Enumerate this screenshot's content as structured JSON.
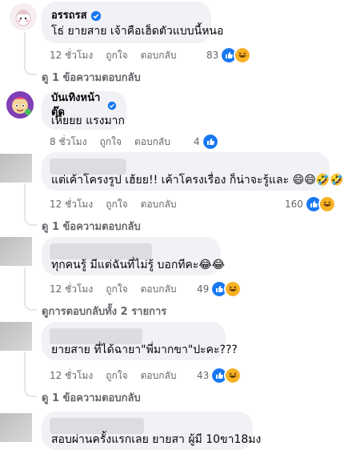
{
  "comments": [
    {
      "author": "อรรถรส",
      "verified": true,
      "text": "โธ่ ยายสาย เจ้าคือเฮ็ดตัวแบบนี้หนอ",
      "time": "12 ชั่วโมง",
      "like": "ถูกใจ",
      "reply": "ตอบกลับ",
      "reaction_count": "83",
      "replies": "ดู 1 ข้อความตอบกลับ"
    },
    {
      "author": "บันเทิงหน้าตุ๊ด",
      "verified": true,
      "text": "เหี้ยยย แรงมาก",
      "time": "8 ชั่วโมง",
      "like": "ถูกใจ",
      "reply": "ตอบกลับ",
      "reaction_count": "4",
      "replies": ""
    },
    {
      "author": "",
      "verified": false,
      "text": "แต่เค้าโครงรูป เฮ้ยย!! เค้าโครงเรื่อง ก็น่าจะรู้และ 😄😄🤣🤣",
      "time": "12 ชั่วโมง",
      "like": "ถูกใจ",
      "reply": "ตอบกลับ",
      "reaction_count": "160",
      "replies": "ดู 1 ข้อความตอบกลับ"
    },
    {
      "author": "",
      "verified": false,
      "text": "ทุกคนรู้ มีแต่ฉันที่ไม่รู้ บอกทีคะ😂😂",
      "time": "12 ชั่วโมง",
      "like": "ถูกใจ",
      "reply": "ตอบกลับ",
      "reaction_count": "49",
      "replies": "ดูการตอบกลับทั้ง 2 รายการ"
    },
    {
      "author": "",
      "verified": false,
      "text": "ยายสาย ที่ได้ฉายา\"พี่มากขา\"ปะคะ???",
      "time": "12 ชั่วโมง",
      "like": "ถูกใจ",
      "reply": "ตอบกลับ",
      "reaction_count": "43",
      "replies": "ดู 1 ข้อความตอบกลับ"
    },
    {
      "author": "",
      "verified": false,
      "text": "สอบผ่านครั้งแรกเลย ยายสา ผู้มี 10ขา18มง",
      "time": "",
      "like": "",
      "reply": "",
      "reaction_count": "",
      "replies": ""
    }
  ],
  "colors": {
    "like_blue": "#1877f2",
    "haha_yellow": "#f7b125",
    "bubble_bg": "#f0f2f5",
    "meta_gray": "#65676b"
  },
  "icons": [
    "verified-badge-icon",
    "like-reaction-icon",
    "haha-reaction-icon",
    "reply-arrow-icon"
  ]
}
